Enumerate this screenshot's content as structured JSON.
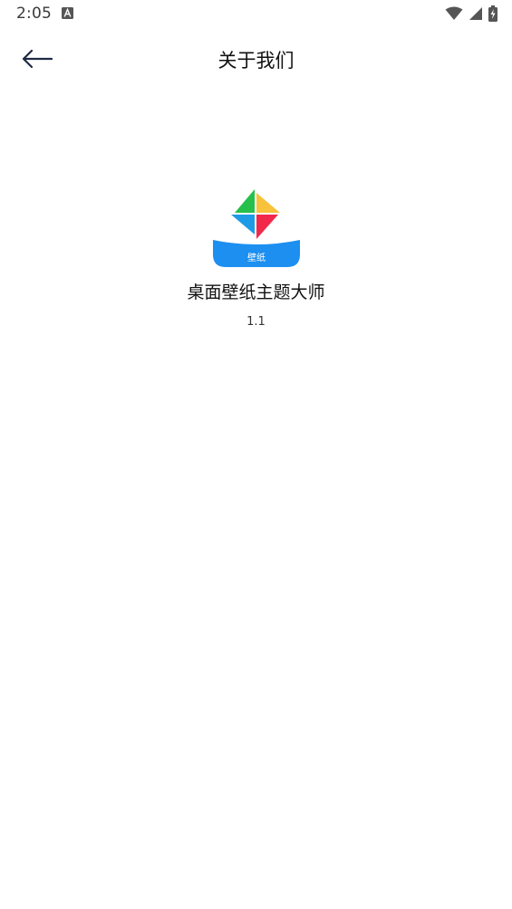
{
  "status_bar": {
    "time": "2:05",
    "icons": [
      "keyboard-a-icon",
      "wifi-icon",
      "cellular-signal-icon",
      "battery-charging-icon"
    ]
  },
  "header": {
    "back_icon": "arrow-left-icon",
    "title": "关于我们"
  },
  "app": {
    "logo_text": "壁纸",
    "name": "桌面壁纸主题大师",
    "version": "1.1"
  },
  "colors": {
    "logo_green": "#27c04a",
    "logo_yellow": "#f9c23c",
    "logo_blue": "#1f9be6",
    "logo_red": "#f2284b",
    "logo_base": "#1c8ff0"
  }
}
